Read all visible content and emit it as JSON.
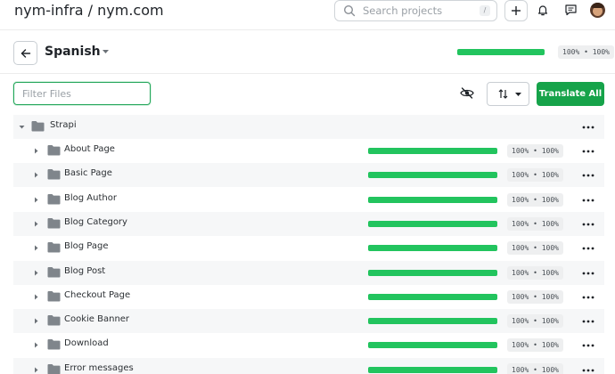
{
  "breadcrumb": "nym-infra / nym.com",
  "search": {
    "placeholder": "Search projects",
    "shortcut": "/"
  },
  "language": {
    "name": "Spanish",
    "progress": "100% • 100%",
    "completion": 1.0
  },
  "filter": {
    "placeholder": "Filter Files"
  },
  "actions": {
    "translate_all": "Translate All"
  },
  "colors": {
    "accent": "#16a34a",
    "progress": "#22c45e"
  },
  "icons": [
    "search-icon",
    "plus-icon",
    "bell-icon",
    "chat-icon",
    "avatar",
    "arrow-left-icon",
    "caret-down-icon",
    "eye-off-icon",
    "sort-icon",
    "folder-icon",
    "chevron-right-icon",
    "chevron-down-icon",
    "more-icon"
  ],
  "tree": {
    "root": {
      "name": "Strapi"
    },
    "items": [
      {
        "name": "About Page",
        "progress": "100% • 100%",
        "completion": 1.0
      },
      {
        "name": "Basic Page",
        "progress": "100% • 100%",
        "completion": 1.0
      },
      {
        "name": "Blog Author",
        "progress": "100% • 100%",
        "completion": 1.0
      },
      {
        "name": "Blog Category",
        "progress": "100% • 100%",
        "completion": 1.0
      },
      {
        "name": "Blog Page",
        "progress": "100% • 100%",
        "completion": 1.0
      },
      {
        "name": "Blog Post",
        "progress": "100% • 100%",
        "completion": 1.0
      },
      {
        "name": "Checkout Page",
        "progress": "100% • 100%",
        "completion": 1.0
      },
      {
        "name": "Cookie Banner",
        "progress": "100% • 100%",
        "completion": 1.0
      },
      {
        "name": "Download",
        "progress": "100% • 100%",
        "completion": 1.0
      },
      {
        "name": "Error messages",
        "progress": "100% • 100%",
        "completion": 1.0
      }
    ]
  }
}
